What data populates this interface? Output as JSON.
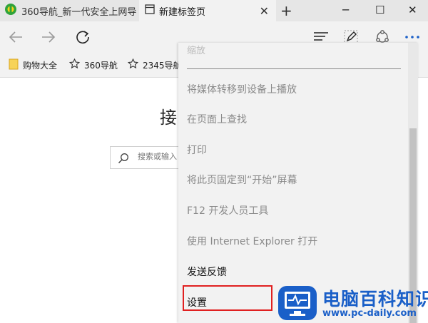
{
  "tabs": [
    {
      "label": "360导航_新一代安全上网导",
      "icon": "360-logo-icon",
      "active": false
    },
    {
      "label": "新建标签页",
      "icon": "tab-page-icon",
      "active": true
    }
  ],
  "tab_close_glyph": "✕",
  "new_tab_glyph": "+",
  "window_controls": {
    "minimize": "─",
    "maximize": "☐",
    "close": "✕"
  },
  "favorites": [
    {
      "label": "购物大全",
      "icon": "folder-icon"
    },
    {
      "label": "360导航",
      "icon": "star-icon"
    },
    {
      "label": "2345导航",
      "icon": "star-icon"
    }
  ],
  "main": {
    "heading_partial": "接",
    "search_placeholder": "搜索或输入"
  },
  "menu": {
    "top_hint": "缩放",
    "items": [
      {
        "label": "将媒体转移到设备上播放",
        "enabled": false
      },
      {
        "label": "在页面上查找",
        "enabled": false
      },
      {
        "label": "打印",
        "enabled": false
      },
      {
        "label": "将此页固定到“开始”屏幕",
        "enabled": false
      },
      {
        "label": "F12 开发人员工具",
        "enabled": false
      },
      {
        "label": "使用 Internet Explorer 打开",
        "enabled": false
      },
      {
        "label": "发送反馈",
        "enabled": true
      },
      {
        "label": "设置",
        "enabled": true,
        "highlighted": true
      }
    ]
  },
  "colors": {
    "highlight_border": "#e02020",
    "watermark_blue": "#1a5fc8",
    "menu_bg": "#f2f2f2"
  },
  "watermark": {
    "title": "电脑百科知识",
    "url": "www.pc-daily.com"
  }
}
